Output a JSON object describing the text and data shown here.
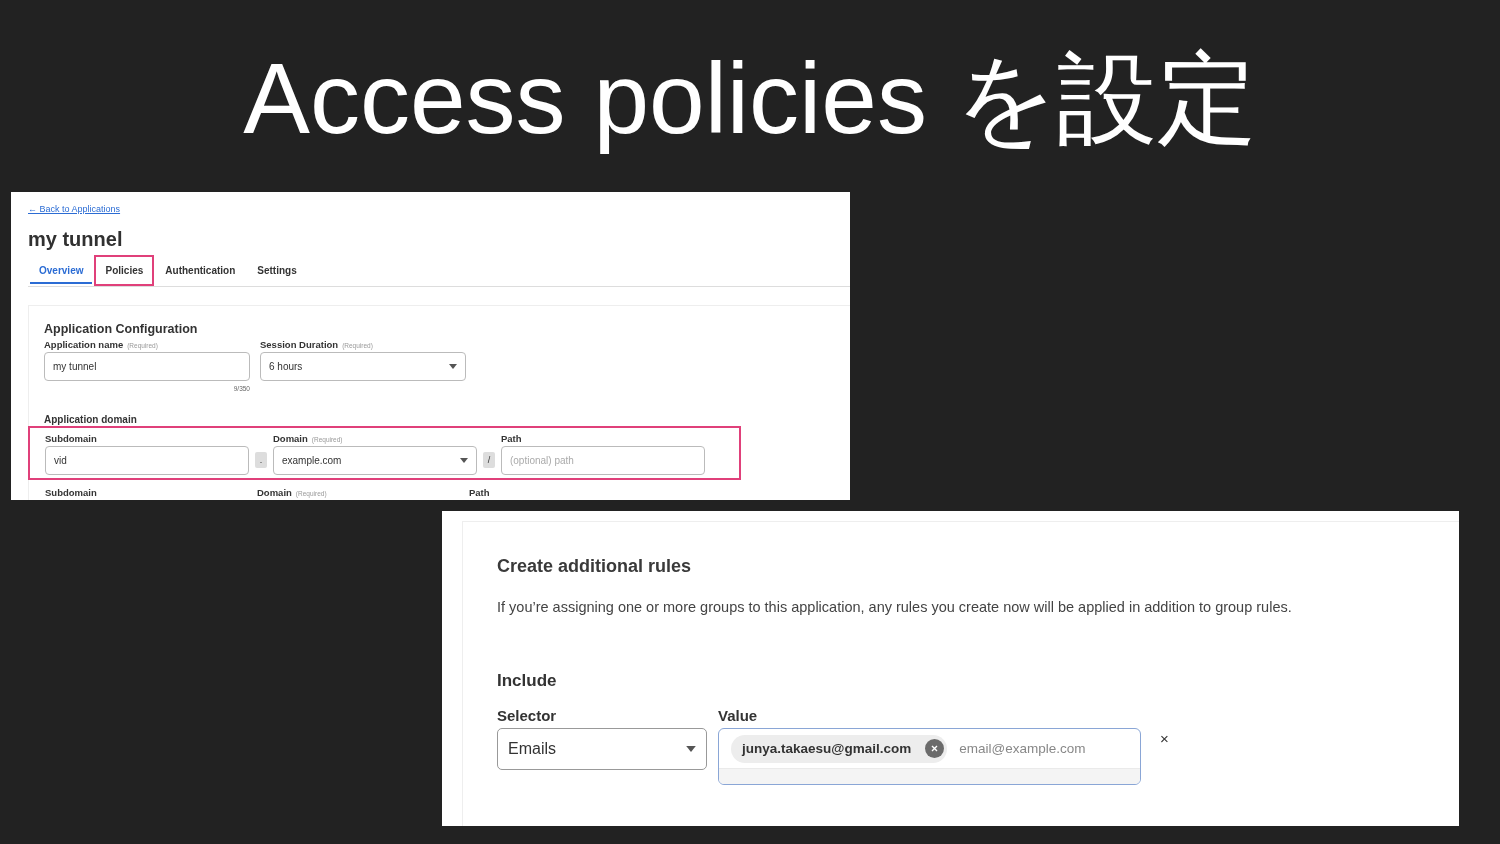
{
  "slide_title": "Access policies を設定",
  "app_screen": {
    "back_link": "← Back to Applications",
    "title": "my tunnel",
    "tabs": [
      {
        "label": "Overview",
        "selected": true,
        "highlighted": false
      },
      {
        "label": "Policies",
        "selected": false,
        "highlighted": true
      },
      {
        "label": "Authentication",
        "selected": false,
        "highlighted": false
      },
      {
        "label": "Settings",
        "selected": false,
        "highlighted": false
      }
    ],
    "section_title": "Application Configuration",
    "fields": [
      {
        "kind": "input",
        "label": "Application name",
        "required": "(Required)",
        "value": "my tunnel",
        "counter": "9/350"
      },
      {
        "kind": "select",
        "label": "Session Duration",
        "required": "(Required)",
        "value": "6 hours"
      }
    ],
    "domain_title": "Application domain",
    "domain_rows": [
      {
        "highlighted": true,
        "subdomain_label": "Subdomain",
        "subdomain_value": "vid",
        "dot": ".",
        "domain_label": "Domain",
        "domain_required": "(Required)",
        "domain_value": "example.com",
        "slash": "/",
        "path_label": "Path",
        "path_placeholder": "(optional) path"
      },
      {
        "highlighted": false,
        "subdomain_label": "Subdomain",
        "domain_label": "Domain",
        "domain_required": "(Required)",
        "path_label": "Path"
      }
    ]
  },
  "rules_screen": {
    "title": "Create additional rules",
    "description": "If you’re assigning one or more groups to this application, any rules you create now will be applied in addition to group rules.",
    "include_title": "Include",
    "selector_label": "Selector",
    "selector_value": "Emails",
    "value_label": "Value",
    "chips": [
      "junya.takaesu@gmail.com"
    ],
    "value_placeholder": "email@example.com",
    "remove": "×"
  }
}
